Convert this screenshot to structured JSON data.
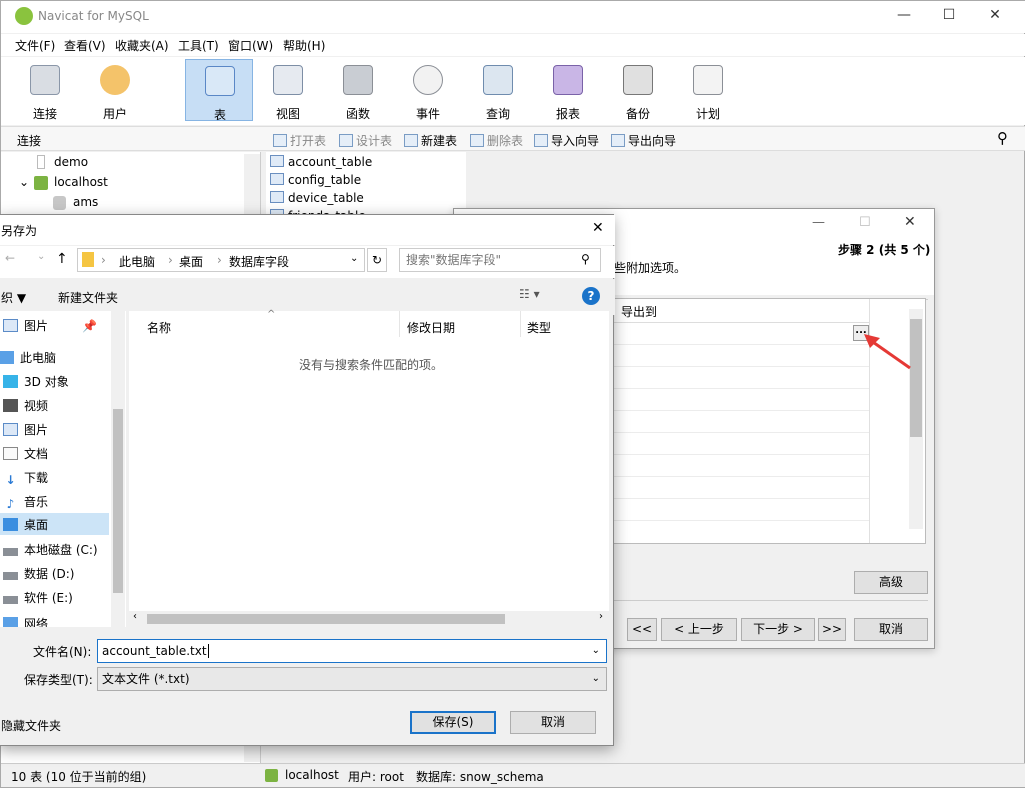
{
  "app": {
    "title": "Navicat for MySQL"
  },
  "menu": [
    "文件(F)",
    "查看(V)",
    "收藏夹(A)",
    "工具(T)",
    "窗口(W)",
    "帮助(H)"
  ],
  "toolbar": [
    {
      "label": "连接",
      "icon": "connection-icon"
    },
    {
      "label": "用户",
      "icon": "user-icon"
    },
    {
      "label": "表",
      "icon": "table-icon"
    },
    {
      "label": "视图",
      "icon": "view-icon"
    },
    {
      "label": "函数",
      "icon": "function-icon"
    },
    {
      "label": "事件",
      "icon": "event-icon"
    },
    {
      "label": "查询",
      "icon": "query-icon"
    },
    {
      "label": "报表",
      "icon": "report-icon"
    },
    {
      "label": "备份",
      "icon": "backup-icon"
    },
    {
      "label": "计划",
      "icon": "schedule-icon"
    }
  ],
  "subbar": {
    "pane_title": "连接",
    "actions": [
      "打开表",
      "设计表",
      "新建表",
      "删除表",
      "导入向导",
      "导出向导"
    ]
  },
  "tree": {
    "items": [
      "demo",
      "localhost",
      "ams"
    ]
  },
  "tables": [
    "account_table",
    "config_table",
    "device_table",
    "friends_table"
  ],
  "status": {
    "left": "10 表 (10 位于当前的组)",
    "connection": "localhost",
    "user": "用户: root",
    "db": "数据库: snow_schema"
  },
  "wizard": {
    "step": "步骤 2 (共 5 个)",
    "hint": "一些附加选项。",
    "col_header": "导出到",
    "advanced": "高级",
    "first": "<<",
    "prev": "< 上一步",
    "next": "下一步 >",
    "last": ">>",
    "cancel": "取消"
  },
  "save": {
    "title": "另存为",
    "path": [
      "此电脑",
      "桌面",
      "数据库字段"
    ],
    "search_placeholder": "搜索\"数据库字段\"",
    "organize": "织 ▼",
    "new_folder": "新建文件夹",
    "nav": [
      "图片",
      "此电脑",
      "3D 对象",
      "视频",
      "图片",
      "文档",
      "下载",
      "音乐",
      "桌面",
      "本地磁盘 (C:)",
      "数据 (D:)",
      "软件 (E:)",
      "网络"
    ],
    "columns": [
      "名称",
      "修改日期",
      "类型"
    ],
    "empty_msg": "没有与搜索条件匹配的项。",
    "filename_label": "文件名(N):",
    "filename": "account_table.txt",
    "filetype_label": "保存类型(T):",
    "filetype": "文本文件 (*.txt)",
    "hide_folders": "隐藏文件夹",
    "save_btn": "保存(S)",
    "cancel_btn": "取消"
  }
}
